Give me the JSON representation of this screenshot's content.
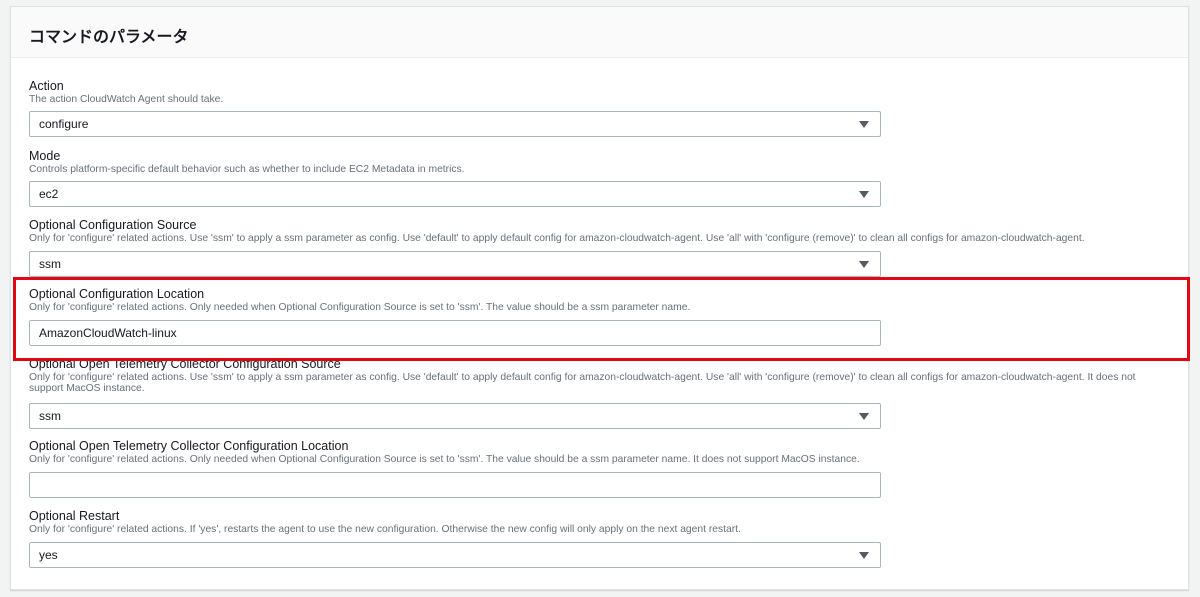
{
  "panel": {
    "title": "コマンドのパラメータ"
  },
  "fields": [
    {
      "label": "Action",
      "description": "The action CloudWatch Agent should take.",
      "value": "configure",
      "control": "select"
    },
    {
      "label": "Mode",
      "description": "Controls platform-specific default behavior such as whether to include EC2 Metadata in metrics.",
      "value": "ec2",
      "control": "select"
    },
    {
      "label": "Optional Configuration Source",
      "description": "Only for 'configure' related actions. Use 'ssm' to apply a ssm parameter as config. Use 'default' to apply default config for amazon-cloudwatch-agent. Use 'all' with 'configure (remove)' to clean all configs for amazon-cloudwatch-agent.",
      "value": "ssm",
      "control": "select"
    },
    {
      "label": "Optional Configuration Location",
      "description": "Only for 'configure' related actions. Only needed when Optional Configuration Source is set to 'ssm'. The value should be a ssm parameter name.",
      "value": "AmazonCloudWatch-linux",
      "control": "text"
    },
    {
      "label": "Optional Open Telemetry Collector Configuration Source",
      "description": "Only for 'configure' related actions. Use 'ssm' to apply a ssm parameter as config. Use 'default' to apply default config for amazon-cloudwatch-agent. Use 'all' with 'configure (remove)' to clean all configs for amazon-cloudwatch-agent. It does not support MacOS instance.",
      "value": "ssm",
      "control": "select"
    },
    {
      "label": "Optional Open Telemetry Collector Configuration Location",
      "description": "Only for 'configure' related actions. Only needed when Optional Configuration Source is set to 'ssm'. The value should be a ssm parameter name. It does not support MacOS instance.",
      "value": "",
      "control": "text"
    },
    {
      "label": "Optional Restart",
      "description": "Only for 'configure' related actions. If 'yes', restarts the agent to use the new configuration. Otherwise the new config will only apply on the next agent restart.",
      "value": "yes",
      "control": "select"
    }
  ],
  "colors": {
    "highlight": "#e30613",
    "border": "#aab7b8",
    "description": "#687078"
  },
  "icons": {
    "select_caret": "caret-down-icon"
  }
}
